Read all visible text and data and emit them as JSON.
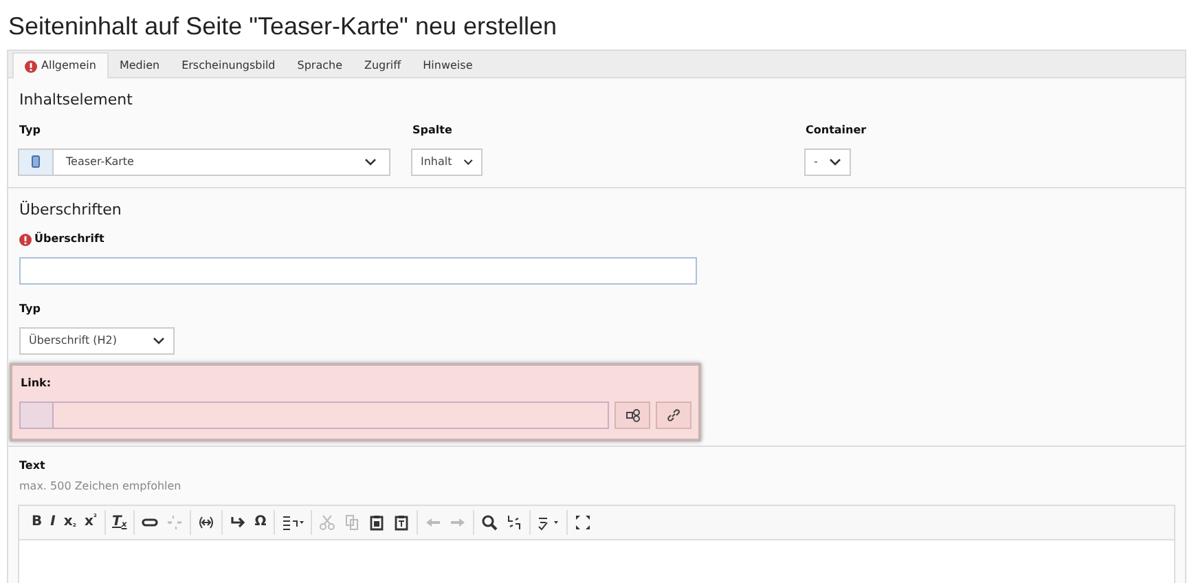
{
  "page_title": "Seiteninhalt auf Seite \"Teaser-Karte\" neu erstellen",
  "tabs": [
    {
      "label": "Allgemein",
      "selected": true,
      "has_error": true
    },
    {
      "label": "Medien",
      "selected": false,
      "has_error": false
    },
    {
      "label": "Erscheinungsbild",
      "selected": false,
      "has_error": false
    },
    {
      "label": "Sprache",
      "selected": false,
      "has_error": false
    },
    {
      "label": "Zugriff",
      "selected": false,
      "has_error": false
    },
    {
      "label": "Hinweise",
      "selected": false,
      "has_error": false
    }
  ],
  "content_element": {
    "heading": "Inhaltselement",
    "type_label": "Typ",
    "type_value": "Teaser-Karte",
    "column_label": "Spalte",
    "column_value": "Inhalt",
    "container_label": "Container",
    "container_value": "-"
  },
  "headings": {
    "heading": "Überschriften",
    "title_label": "Überschrift",
    "title_required": true,
    "type_label": "Typ",
    "type_value": "Überschrift (H2)",
    "link_label": "Link:",
    "link_invalid": true
  },
  "text": {
    "label": "Text",
    "hint": "max. 500 Zeichen empfohlen",
    "toolbar": [
      [
        {
          "kind": "text",
          "label": "B",
          "disabled": false
        },
        {
          "kind": "text",
          "label": "I",
          "disabled": false
        },
        {
          "kind": "text",
          "label": "x$_{₂}$",
          "disabled": false
        },
        {
          "kind": "text",
          "label": "x$^{²}$",
          "disabled": false
        }
      ],
      [
        {
          "kind": "text",
          "label": "T$_{x}$",
          "disabled": false
        }
      ],
      [
        {
          "kind": "icon",
          "disabled": false
        },
        {
          "kind": "icon",
          "disabled": true
        }
      ],
      [
        {
          "kind": "icon",
          "disabled": false
        }
      ],
      [
        {
          "kind": "icon",
          "disabled": false
        },
        {
          "kind": "text",
          "label": "Ω",
          "disabled": false
        }
      ],
      [
        {
          "kind": "icon",
          "disabled": false
        }
      ],
      [
        {
          "kind": "icon",
          "disabled": true
        },
        {
          "kind": "icon",
          "disabled": true
        },
        {
          "kind": "icon",
          "disabled": false
        },
        {
          "kind": "icon",
          "disabled": false
        }
      ],
      [
        {
          "kind": "icon",
          "disabled": true
        },
        {
          "kind": "icon",
          "disabled": true
        }
      ],
      [
        {
          "kind": "icon",
          "disabled": false
        },
        {
          "kind": "icon",
          "disabled": false
        }
      ],
      [
        {
          "kind": "icon",
          "disabled": false
        }
      ],
      [
        {
          "kind": "icon",
          "disabled": false
        }
      ]
    ]
  }
}
